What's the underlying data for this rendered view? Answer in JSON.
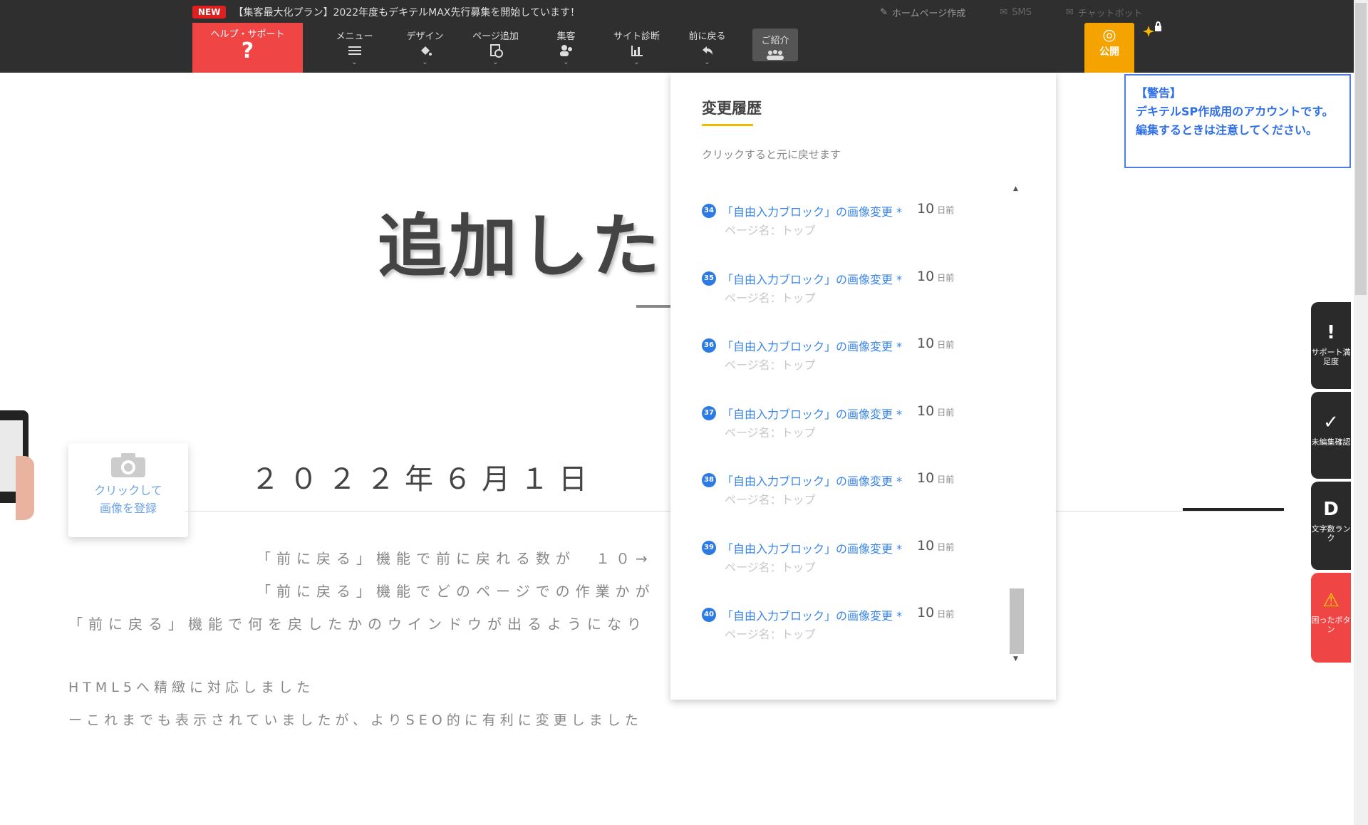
{
  "topbar": {
    "new_badge": "NEW",
    "news_text": "【集客最大化プラン】2022年度もデキテルMAX先行募集を開始しています！",
    "links": {
      "homepage": "ホームページ作成",
      "sms": "SMS",
      "chatbot": "チャットボット"
    },
    "help": {
      "label": "ヘルプ・サポート",
      "glyph": "?"
    },
    "menu": [
      {
        "label": "メニュー",
        "icon": "hamburger-icon"
      },
      {
        "label": "デザイン",
        "icon": "paint-bucket-icon"
      },
      {
        "label": "ページ追加",
        "icon": "page-add-icon"
      },
      {
        "label": "集客",
        "icon": "users-icon"
      },
      {
        "label": "サイト診断",
        "icon": "bar-chart-icon"
      },
      {
        "label": "前に戻る",
        "icon": "undo-icon"
      },
      {
        "label": "ご紹介",
        "icon": "group-icon"
      }
    ],
    "publish": {
      "label": "公開",
      "icon": "globe-icon"
    }
  },
  "canvas": {
    "title": "追加した",
    "image_card": {
      "line1": "クリックして",
      "line2": "画像を登録"
    },
    "date": "２０２２年６月１日",
    "body_lines": [
      "「前に戻る」機能で前に戻れる数が　１０→",
      "「前に戻る」機能でどのページでの作業かが",
      "「前に戻る」機能で何を戻したかのウインドウが出るようになり",
      "HTML5へ精緻に対応しました",
      "ーこれまでも表示されていましたが、よりSEO的に有利に変更しました"
    ]
  },
  "history": {
    "title": "変更履歴",
    "subtitle": "クリックすると元に戻せます",
    "items": [
      {
        "num": "34",
        "label": "「自由入力ブロック」の画像変更 *",
        "page": "ページ名：トップ",
        "ago": "10",
        "unit": "日前"
      },
      {
        "num": "35",
        "label": "「自由入力ブロック」の画像変更 *",
        "page": "ページ名：トップ",
        "ago": "10",
        "unit": "日前"
      },
      {
        "num": "36",
        "label": "「自由入力ブロック」の画像変更 *",
        "page": "ページ名：トップ",
        "ago": "10",
        "unit": "日前"
      },
      {
        "num": "37",
        "label": "「自由入力ブロック」の画像変更 *",
        "page": "ページ名：トップ",
        "ago": "10",
        "unit": "日前"
      },
      {
        "num": "38",
        "label": "「自由入力ブロック」の画像変更 *",
        "page": "ページ名：トップ",
        "ago": "10",
        "unit": "日前"
      },
      {
        "num": "39",
        "label": "「自由入力ブロック」の画像変更 *",
        "page": "ページ名：トップ",
        "ago": "10",
        "unit": "日前"
      },
      {
        "num": "40",
        "label": "「自由入力ブロック」の画像変更 *",
        "page": "ページ名：トップ",
        "ago": "10",
        "unit": "日前"
      }
    ]
  },
  "notice": {
    "heading": "【警告】",
    "body": "デキテルSP作成用のアカウントです。編集するときは注意してください。"
  },
  "side_tabs": [
    {
      "icon": "!",
      "label": "サポート満足度"
    },
    {
      "icon": "✓",
      "label": "未編集確認"
    },
    {
      "icon": "D",
      "label": "文字数ランク"
    },
    {
      "icon": "⚠",
      "label": "困ったボタン"
    }
  ],
  "colors": {
    "toolbar_bg": "#2f2f2f",
    "help_red": "#f04545",
    "publish_orange": "#f5a300",
    "link_blue": "#3a86e8",
    "accent_yellow": "#f5b800"
  }
}
